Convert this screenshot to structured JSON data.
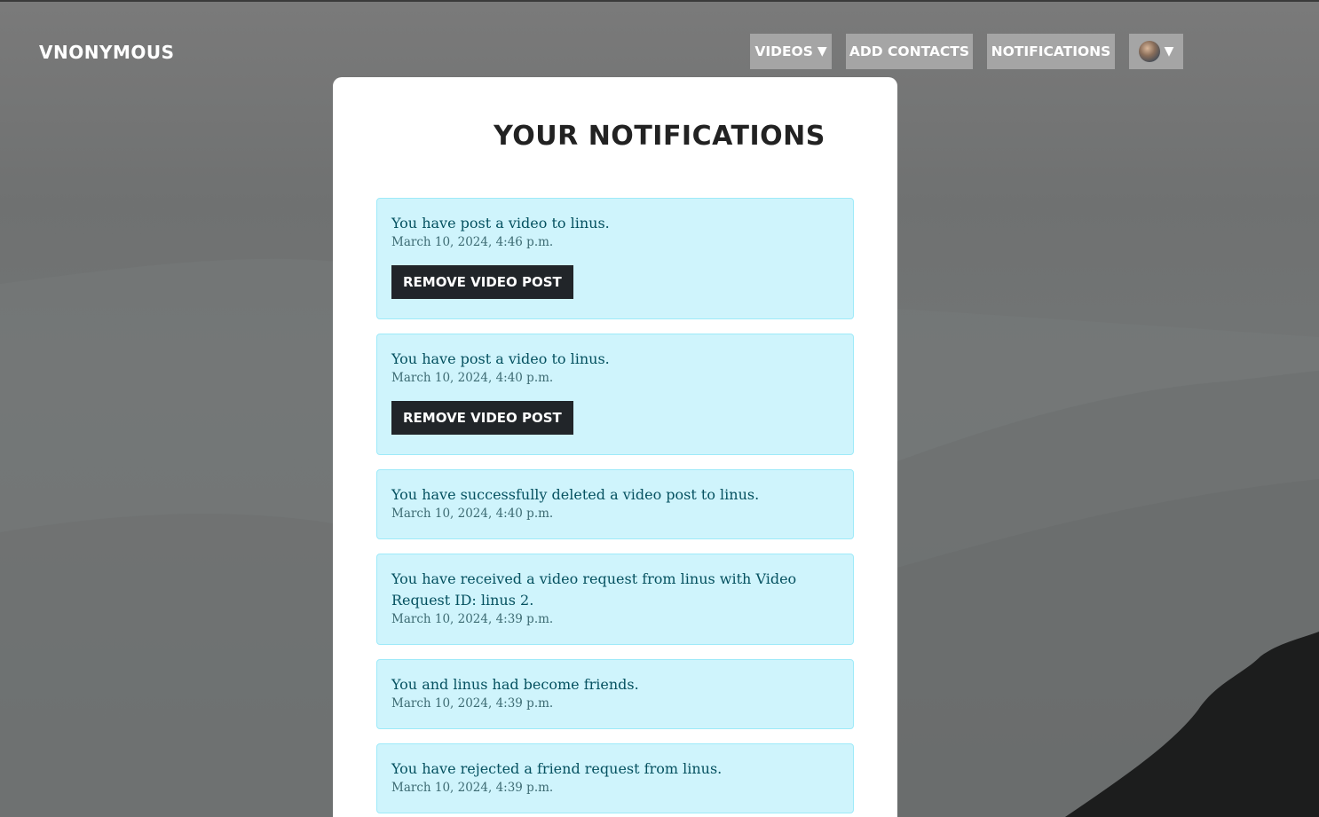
{
  "header": {
    "brand": "VNONYMOUS",
    "nav": {
      "videos_label": "VIDEOS",
      "add_contacts_label": "ADD CONTACTS",
      "notifications_label": "NOTIFICATIONS",
      "caret": "▼"
    }
  },
  "main": {
    "title": "YOUR NOTIFICATIONS",
    "notifications": [
      {
        "message": "You have post a video to linus.",
        "time": "March 10, 2024, 4:46 p.m.",
        "button_label": "REMOVE VIDEO POST"
      },
      {
        "message": "You have post a video to linus.",
        "time": "March 10, 2024, 4:40 p.m.",
        "button_label": "REMOVE VIDEO POST"
      },
      {
        "message": "You have successfully deleted a video post to linus.",
        "time": "March 10, 2024, 4:40 p.m."
      },
      {
        "message": "You have received a video request from linus with Video Request ID: linus 2.",
        "time": "March 10, 2024, 4:39 p.m."
      },
      {
        "message": "You and linus had become friends.",
        "time": "March 10, 2024, 4:39 p.m."
      },
      {
        "message": "You have rejected a friend request from linus.",
        "time": "March 10, 2024, 4:39 p.m."
      }
    ]
  },
  "colors": {
    "nav_button_bg": "#a5a5a5",
    "notification_bg": "#cff4fc",
    "notification_border": "#9eeaf9",
    "notification_text": "#055160",
    "button_bg": "#212529"
  }
}
